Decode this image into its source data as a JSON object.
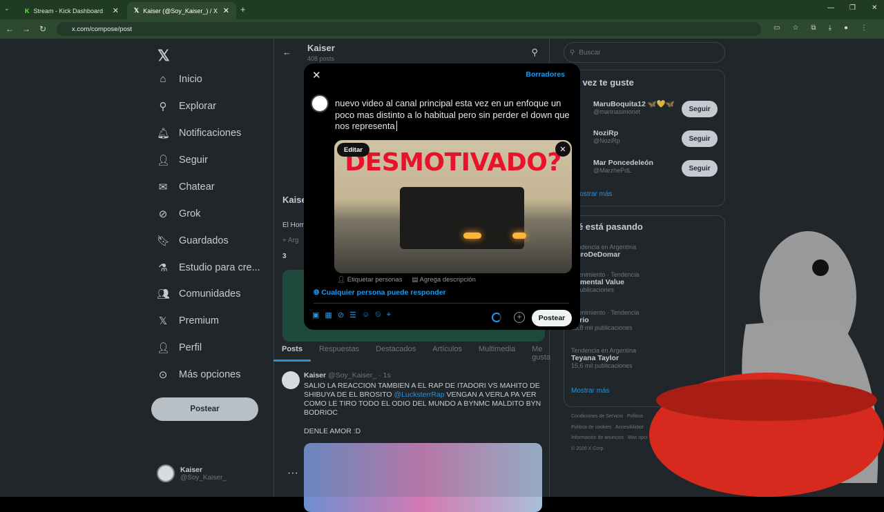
{
  "browser": {
    "tabs": [
      {
        "label": "Stream - Kick Dashboard"
      },
      {
        "label": "Kaiser (@Soy_Kaiser_) / X"
      }
    ],
    "url": "x.com/compose/post"
  },
  "nav": {
    "items": [
      "Inicio",
      "Explorar",
      "Notificaciones",
      "Seguir",
      "Chatear",
      "Grok",
      "Guardados",
      "Estudio para cre...",
      "Comunidades",
      "Premium",
      "Perfil",
      "Más opciones"
    ],
    "post_label": "Postear",
    "account_name": "Kaiser",
    "account_handle": "@Soy_Kaiser_"
  },
  "profile": {
    "name": "Kaiser",
    "posts": "408 posts",
    "bio": "El Hom",
    "location": "Arg",
    "following": "3"
  },
  "profile_tabs": [
    "Posts",
    "Respuestas",
    "Destacados",
    "Artículos",
    "Multimedia",
    "Me gusta"
  ],
  "tweet": {
    "author": "Kaiser",
    "handle": "@Soy_Kaiser_ · 1s",
    "text_a": "SALIO LA REACCION TAMBIEN A EL RAP DE ITADORI VS MAHITO DE SHIBUYA DE EL BROSITO ",
    "mention": "@LucksterrRap",
    "text_b": " VENGAN A VERLA PA VER COMO LE TIRO TODO EL ODIO DEL MUNDO A BYNMC MALDITO BYN BODRIOC",
    "text_c": "DENLE AMOR :D"
  },
  "compose": {
    "drafts": "Borradores",
    "text": "nuevo video al canal principal esta vez en un enfoque un poco mas distinto a lo habitual pero sin perder el down que nos representa",
    "media_text": "DESMOTIVADO?",
    "edit": "Editar",
    "tag_people": "Etiquetar personas",
    "add_desc": "Agrega descripción",
    "reply_setting": "Cualquier persona puede responder",
    "post_label": "Postear"
  },
  "right": {
    "search_placeholder": "Buscar",
    "who_title": "al vez te guste",
    "follow_label": "Seguir",
    "suggestions": [
      {
        "name": "MaruBoquita12 🦋💛🦋",
        "handle": "@marinasimonet"
      },
      {
        "name": "NoziRp",
        "handle": "@NoziRp"
      },
      {
        "name": "Mar Poncedeleón",
        "handle": "@MarzhePdL"
      }
    ],
    "show_more": "Mostrar más",
    "trends_title": "ué está pasando",
    "trends": [
      {
        "ctx": "Tendencia en Argentina",
        "name": "DuroDeDomar",
        "count": ""
      },
      {
        "ctx": "retenimiento · Tendencia",
        "name": "ntimental Value",
        "count": "1 publicaciones"
      },
      {
        "ctx": "retenimiento · Tendencia",
        "name": "aprio",
        "count": "15,8 mil publicaciones"
      },
      {
        "ctx": "Tendencia en Argentina",
        "name": "Teyana Taylor",
        "count": "15,6 mil publicaciones"
      }
    ],
    "trends_more": "Mostrar más",
    "footer": [
      "Condiciones de Servicio",
      "Política",
      "Política de cookies",
      "Accesibilidad",
      "Información de anuncios",
      "Más opci",
      "© 2026 X Corp."
    ]
  }
}
